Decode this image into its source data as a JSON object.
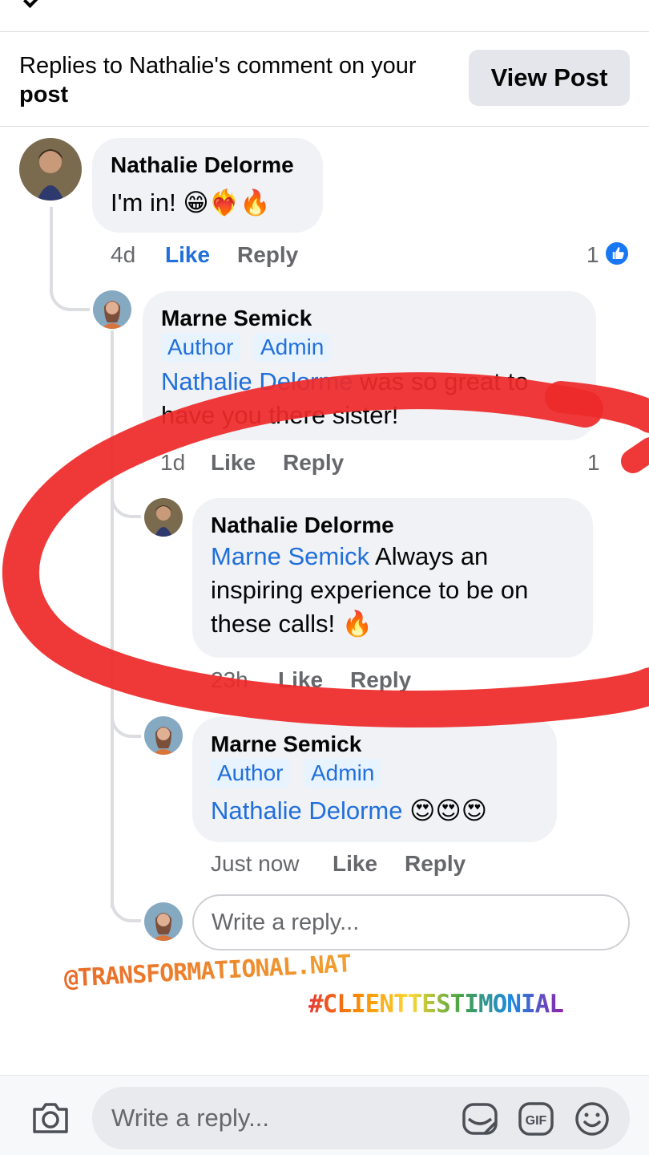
{
  "header": {
    "reply_text": "Replies to Nathalie's comment on your",
    "reply_text_bold": "post",
    "view_post_label": "View Post"
  },
  "comments": [
    {
      "name": "Nathalie Delorme",
      "text": "I'm in!",
      "emojis": "😁❤️‍🔥🔥",
      "time": "4d",
      "like": "Like",
      "reply": "Reply",
      "reactions": "1"
    },
    {
      "name": "Marne Semick",
      "badges": [
        "Author",
        "Admin"
      ],
      "mention": "Nathalie Delorme",
      "text": "was so great to have you there sister!",
      "time": "1d",
      "like": "Like",
      "reply": "Reply",
      "reactions": "1"
    },
    {
      "name": "Nathalie Delorme",
      "mention": "Marne Semick",
      "text_line1": "Always an",
      "text_line2": "inspiring experience to be on",
      "text_line3": "these calls!",
      "emojis": "🔥",
      "time": "23h",
      "like": "Like",
      "reply": "Reply"
    },
    {
      "name": "Marne Semick",
      "badges": [
        "Author",
        "Admin"
      ],
      "mention": "Nathalie Delorme",
      "emojis": "😍😍😍",
      "time": "Just now",
      "like": "Like",
      "reply": "Reply"
    }
  ],
  "reply_box": {
    "placeholder": "Write a reply..."
  },
  "overlay_text": {
    "handle": "@TRANSFORMATIONAL.NAT",
    "hashtag": "#CLIENTTESTIMONIAL"
  },
  "bottom_bar": {
    "placeholder": "Write a reply...",
    "icons": [
      "camera-icon",
      "sticker-icon",
      "gif-icon",
      "emoji-icon"
    ],
    "gif_label": "GIF"
  },
  "colors": {
    "mention_blue": "#216fdb",
    "like_blue": "#1877f2",
    "bubble_grey": "#f0f2f5",
    "annotation_red": "#ee2a2a"
  }
}
